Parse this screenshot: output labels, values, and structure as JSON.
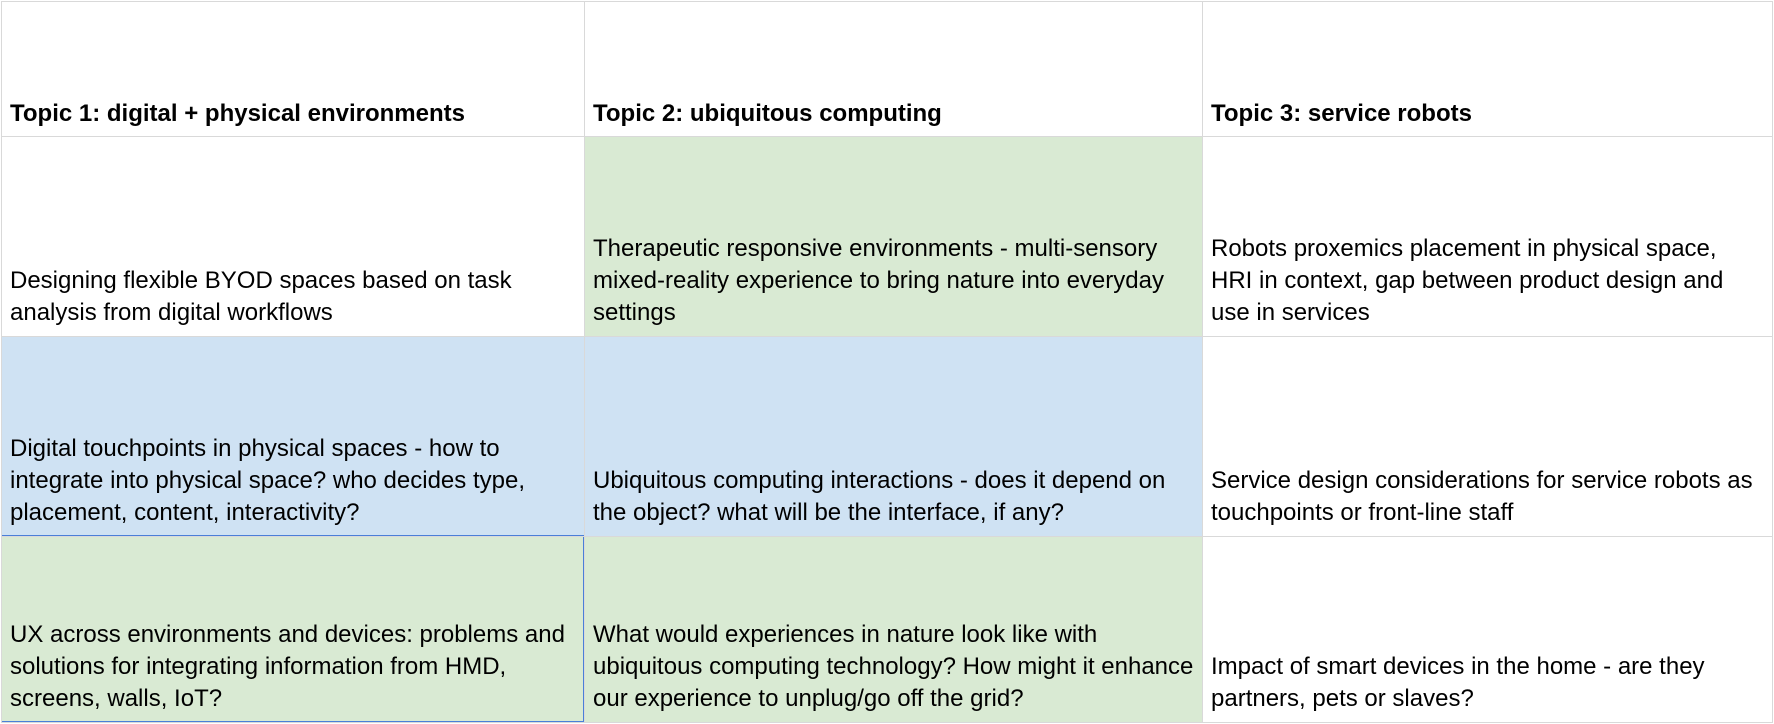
{
  "colors": {
    "green_fill": "#d9ead3",
    "blue_fill": "#cfe2f3",
    "white_fill": "#ffffff",
    "selection_border": "#4a7fd8"
  },
  "headers": [
    "Topic 1: digital + physical environments",
    "Topic 2: ubiquitous computing",
    "Topic 3: service robots"
  ],
  "rows": [
    [
      {
        "text": "Designing flexible BYOD spaces based on task analysis from digital workflows",
        "fill": "white"
      },
      {
        "text": "Therapeutic responsive environments - multi-sensory mixed-reality experience to bring nature into everyday settings",
        "fill": "green"
      },
      {
        "text": "Robots proxemics placement in physical space, HRI in context, gap between product design and use in services",
        "fill": "white"
      }
    ],
    [
      {
        "text": "Digital touchpoints in physical spaces - how to integrate into physical space? who decides type, placement, content, interactivity?",
        "fill": "blue"
      },
      {
        "text": "Ubiquitous computing interactions - does it depend on the object? what will be the interface, if any?",
        "fill": "blue"
      },
      {
        "text": "Service design considerations for service robots as touchpoints or front-line staff",
        "fill": "white"
      }
    ],
    [
      {
        "text": "UX across environments and devices: problems and solutions for integrating information from HMD, screens, walls, IoT?",
        "fill": "green"
      },
      {
        "text": "What would experiences in nature look like with ubiquitous computing technology? How might it enhance our experience to unplug/go off the grid?",
        "fill": "green"
      },
      {
        "text": "Impact of smart devices in the home - are they partners, pets or slaves?",
        "fill": "white"
      }
    ]
  ]
}
